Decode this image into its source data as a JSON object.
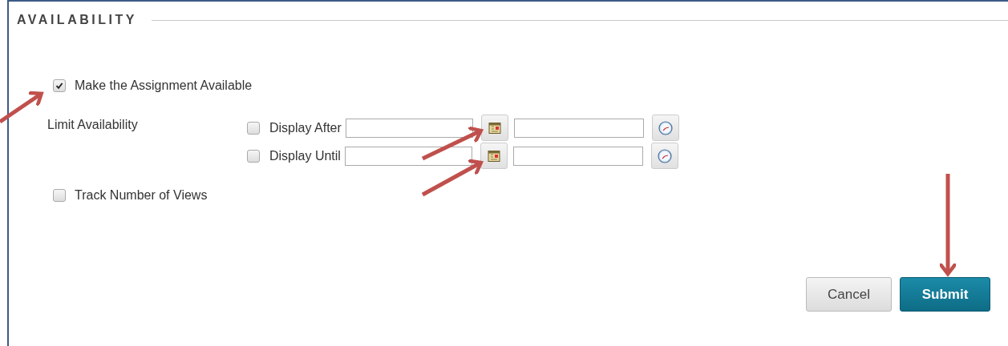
{
  "section": {
    "title": "AVAILABILITY"
  },
  "make_available": {
    "label": "Make the Assignment Available",
    "checked": true
  },
  "limit_availability": {
    "label": "Limit Availability",
    "rows": [
      {
        "label": "Display After",
        "checked": false
      },
      {
        "label": "Display Until",
        "checked": false
      }
    ]
  },
  "track_views": {
    "label": "Track Number of Views",
    "checked": false
  },
  "buttons": [
    {
      "label": "Cancel",
      "kind": "secondary"
    },
    {
      "label": "Submit",
      "kind": "primary"
    }
  ]
}
